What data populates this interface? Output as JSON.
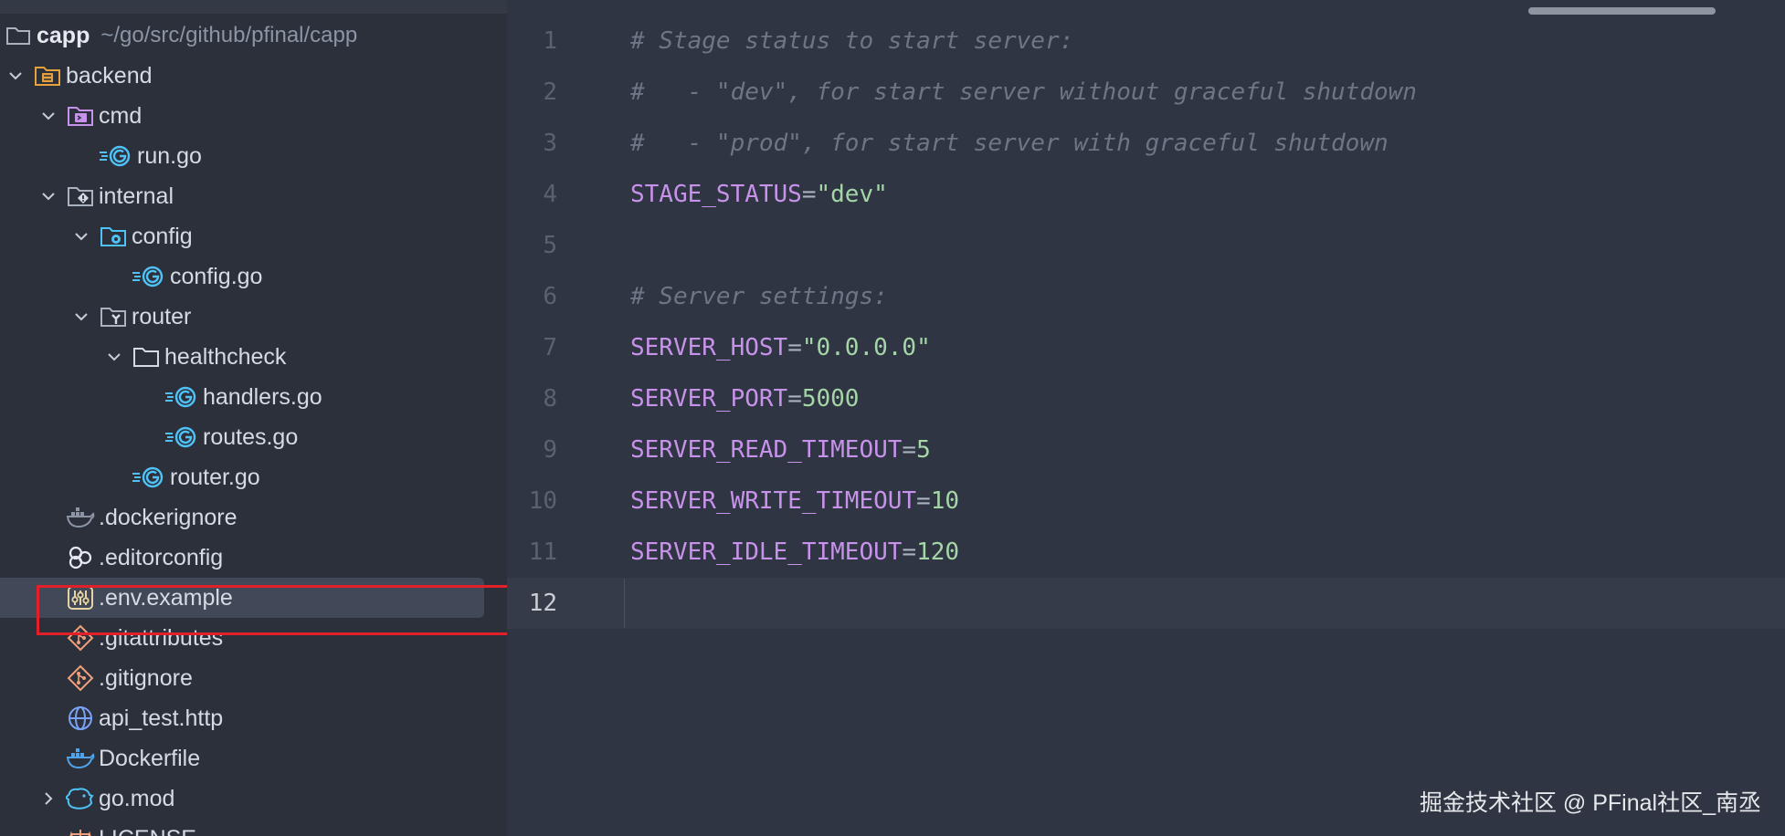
{
  "project": {
    "name": "capp",
    "path": "~/go/src/github/pfinal/capp"
  },
  "tree": [
    {
      "label": "backend",
      "depth": 0,
      "expanded": true,
      "icon": "backend-folder-icon"
    },
    {
      "label": "cmd",
      "depth": 1,
      "expanded": true,
      "icon": "cmd-folder-icon"
    },
    {
      "label": "run.go",
      "depth": 2,
      "icon": "go-file-icon"
    },
    {
      "label": "internal",
      "depth": 1,
      "expanded": true,
      "icon": "internal-folder-icon"
    },
    {
      "label": "config",
      "depth": 2,
      "expanded": true,
      "icon": "config-folder-icon"
    },
    {
      "label": "config.go",
      "depth": 3,
      "icon": "go-file-icon"
    },
    {
      "label": "router",
      "depth": 2,
      "expanded": true,
      "icon": "router-folder-icon"
    },
    {
      "label": "healthcheck",
      "depth": 3,
      "expanded": true,
      "icon": "folder-icon"
    },
    {
      "label": "handlers.go",
      "depth": 4,
      "icon": "go-file-icon"
    },
    {
      "label": "routes.go",
      "depth": 4,
      "icon": "go-file-icon"
    },
    {
      "label": "router.go",
      "depth": 3,
      "icon": "go-file-icon"
    },
    {
      "label": ".dockerignore",
      "depth": 1,
      "icon": "docker-ignore-icon"
    },
    {
      "label": ".editorconfig",
      "depth": 1,
      "icon": "editorconfig-icon"
    },
    {
      "label": ".env.example",
      "depth": 1,
      "icon": "env-settings-icon",
      "selected": true
    },
    {
      "label": ".gitattributes",
      "depth": 1,
      "icon": "git-icon"
    },
    {
      "label": ".gitignore",
      "depth": 1,
      "icon": "git-icon"
    },
    {
      "label": "api_test.http",
      "depth": 1,
      "icon": "globe-icon"
    },
    {
      "label": "Dockerfile",
      "depth": 1,
      "icon": "docker-icon"
    },
    {
      "label": "go.mod",
      "depth": 1,
      "collapsed": true,
      "icon": "go-mod-icon"
    },
    {
      "label": "LICENSE",
      "depth": 1,
      "icon": "license-icon"
    }
  ],
  "editor": {
    "current_line": 12,
    "lines": [
      {
        "n": "1",
        "text": "# Stage status to start server:",
        "kind": "comment"
      },
      {
        "n": "2",
        "text": "#   - \"dev\", for start server without graceful shutdown",
        "kind": "comment"
      },
      {
        "n": "3",
        "text": "#   - \"prod\", for start server with graceful shutdown",
        "kind": "comment"
      },
      {
        "n": "4",
        "key": "STAGE_STATUS",
        "value": "\"dev\"",
        "kind": "kv"
      },
      {
        "n": "5",
        "text": "",
        "kind": "blank"
      },
      {
        "n": "6",
        "text": "# Server settings:",
        "kind": "comment"
      },
      {
        "n": "7",
        "key": "SERVER_HOST",
        "value": "\"0.0.0.0\"",
        "kind": "kv"
      },
      {
        "n": "8",
        "key": "SERVER_PORT",
        "value": "5000",
        "kind": "kv"
      },
      {
        "n": "9",
        "key": "SERVER_READ_TIMEOUT",
        "value": "5",
        "kind": "kv"
      },
      {
        "n": "10",
        "key": "SERVER_WRITE_TIMEOUT",
        "value": "10",
        "kind": "kv"
      },
      {
        "n": "11",
        "key": "SERVER_IDLE_TIMEOUT",
        "value": "120",
        "kind": "kv"
      },
      {
        "n": "12",
        "text": "",
        "kind": "blank"
      }
    ]
  },
  "watermark": "掘金技术社区 @ PFinal社区_南丞",
  "colors": {
    "highlight_box": "#e2202a",
    "key": "#c792ea",
    "value": "#a5d6a7",
    "comment": "#6e7686"
  }
}
